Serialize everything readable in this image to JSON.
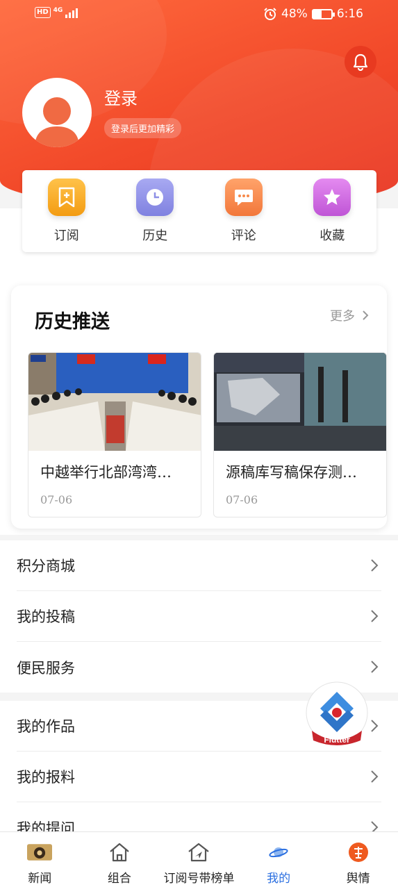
{
  "status_bar": {
    "network": "4G",
    "hd": "HD",
    "battery": "48%",
    "time": "6:16"
  },
  "profile": {
    "login_label": "登录",
    "login_hint": "登录后更加精彩"
  },
  "quick_actions": [
    {
      "label": "订阅",
      "icon": "bookmark-plus-icon",
      "color": "#f7a822"
    },
    {
      "label": "历史",
      "icon": "clock-icon",
      "color": "#8d8fe6"
    },
    {
      "label": "评论",
      "icon": "comment-icon",
      "color": "#f7894a"
    },
    {
      "label": "收藏",
      "icon": "star-icon",
      "color": "#cf6be0"
    }
  ],
  "history": {
    "title": "历史推送",
    "more_label": "更多",
    "items": [
      {
        "title": "中越举行北部湾湾…",
        "date": "07-06",
        "image": "meeting-photo"
      },
      {
        "title": "源稿库写稿保存测…",
        "date": "07-06",
        "image": "exhibition-photo"
      }
    ]
  },
  "menu_groups": [
    [
      "积分商城",
      "我的投稿",
      "便民服务"
    ],
    [
      "我的作品",
      "我的报料",
      "我的提问"
    ]
  ],
  "flutter_badge": {
    "label": "Flutter"
  },
  "tabs": [
    {
      "label": "新闻",
      "icon": "news-icon",
      "active": false
    },
    {
      "label": "组合",
      "icon": "home-icon",
      "active": false
    },
    {
      "label": "订阅号带榜单",
      "icon": "send-icon",
      "active": false
    },
    {
      "label": "我的",
      "icon": "planet-icon",
      "active": true
    },
    {
      "label": "舆情",
      "icon": "hot-icon",
      "active": false
    }
  ],
  "colors": {
    "brand_red": "#f24a2a",
    "active_tab": "#2b6fe0"
  }
}
